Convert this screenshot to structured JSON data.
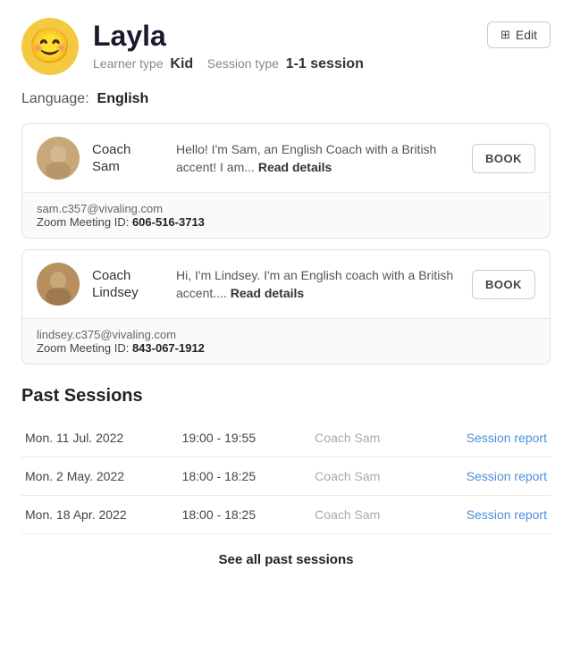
{
  "header": {
    "name": "Layla",
    "learner_type_label": "Learner type",
    "learner_type_value": "Kid",
    "session_type_label": "Session type",
    "session_type_value": "1-1 session",
    "edit_button_label": "Edit",
    "avatar_emoji": "😊"
  },
  "language": {
    "label": "Language:",
    "value": "English"
  },
  "coaches": [
    {
      "id": "sam",
      "first_name": "Coach",
      "last_name": "Sam",
      "bio_text": "Hello! I'm Sam, an English Coach with a British accent! I am...",
      "read_details_label": "Read details",
      "book_label": "BOOK",
      "email": "sam.c357@vivaling.com",
      "zoom_label": "Zoom Meeting ID:",
      "zoom_id": "606-516-3713"
    },
    {
      "id": "lindsey",
      "first_name": "Coach",
      "last_name": "Lindsey",
      "bio_text": "Hi, I'm Lindsey. I'm an English coach with a British accent....",
      "read_details_label": "Read details",
      "book_label": "BOOK",
      "email": "lindsey.c375@vivaling.com",
      "zoom_label": "Zoom Meeting ID:",
      "zoom_id": "843-067-1912"
    }
  ],
  "past_sessions": {
    "title": "Past Sessions",
    "sessions": [
      {
        "date": "Mon. 11 Jul. 2022",
        "time": "19:00 - 19:55",
        "coach": "Coach Sam",
        "report_label": "Session report"
      },
      {
        "date": "Mon. 2 May. 2022",
        "time": "18:00 - 18:25",
        "coach": "Coach Sam",
        "report_label": "Session report"
      },
      {
        "date": "Mon. 18 Apr. 2022",
        "time": "18:00 - 18:25",
        "coach": "Coach Sam",
        "report_label": "Session report"
      }
    ],
    "see_all_label": "See all past sessions"
  }
}
